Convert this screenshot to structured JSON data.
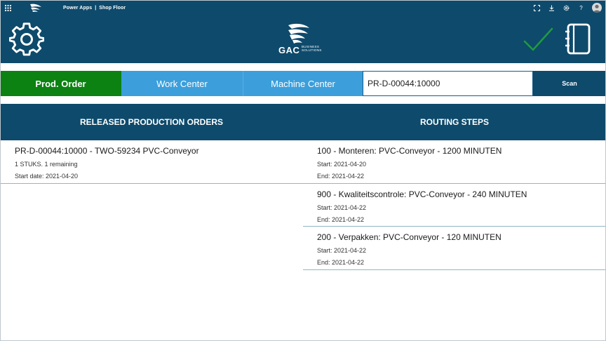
{
  "appbar": {
    "app_name": "Power Apps",
    "separator": "|",
    "screen_name": "Shop Floor",
    "icons": [
      "waffle-icon",
      "fit-screen-icon",
      "download-icon",
      "settings-icon",
      "help-icon",
      "avatar"
    ],
    "help_label": "?"
  },
  "header": {
    "brand_name": "GAC",
    "brand_sub_1": "BUSINESS",
    "brand_sub_2": "SOLUTIONS",
    "icons": [
      "gear-icon",
      "checkmark-icon",
      "notebook-icon"
    ],
    "colors": {
      "bar": "#0e4a6b",
      "check": "#1f9b3f"
    }
  },
  "tabs": {
    "prod_order": "Prod. Order",
    "work_center": "Work Center",
    "machine_center": "Machine Center",
    "active": "Prod. Order",
    "colors": {
      "active": "#0b8212",
      "inactive": "#3c9fdb"
    }
  },
  "scan": {
    "value": "PR-D-00044:10000",
    "button_label": "Scan"
  },
  "columns": {
    "left_title": "RELEASED PRODUCTION ORDERS",
    "right_title": "ROUTING STEPS"
  },
  "orders": [
    {
      "title": "PR-D-00044:10000 - TWO-59234 PVC-Conveyor",
      "quantity": "1 STUKS. 1 remaining",
      "start": "Start date: 2021-04-20"
    }
  ],
  "steps": [
    {
      "title": "100 - Monteren: PVC-Conveyor - 1200 MINUTEN",
      "start": "Start: 2021-04-20",
      "end": "End: 2021-04-22"
    },
    {
      "title": "900 - Kwaliteitscontrole: PVC-Conveyor - 240 MINUTEN",
      "start": "Start: 2021-04-22",
      "end": "End: 2021-04-22"
    },
    {
      "title": "200 - Verpakken: PVC-Conveyor - 120 MINUTEN",
      "start": "Start: 2021-04-22",
      "end": "End: 2021-04-22"
    }
  ]
}
